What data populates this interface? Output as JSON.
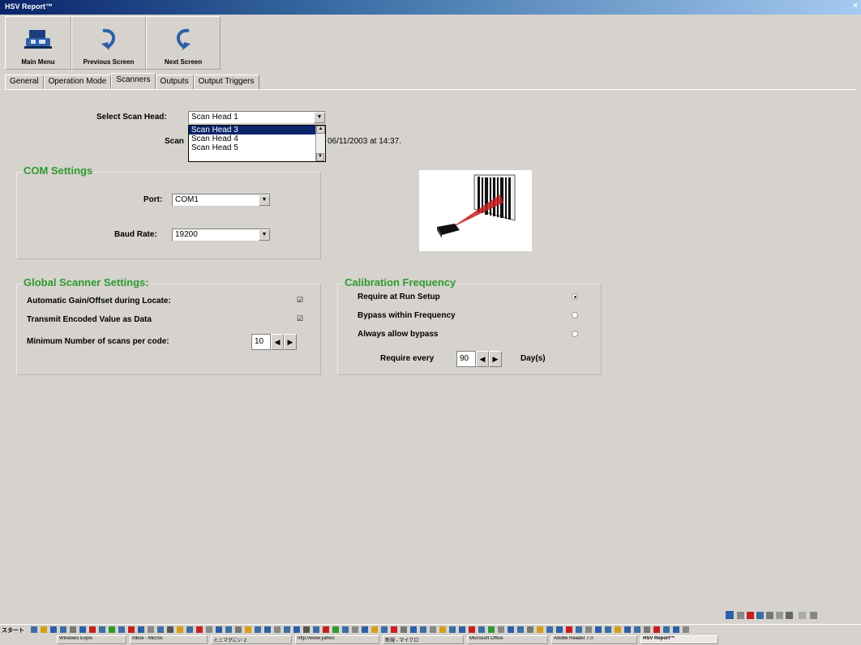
{
  "window": {
    "title": "HSV Report™",
    "close_glyph": "×"
  },
  "toolbar": {
    "main_menu": "Main Menu",
    "previous_screen": "Previous Screen",
    "next_screen": "Next Screen"
  },
  "tabs": [
    {
      "label": "General"
    },
    {
      "label": "Operation Mode"
    },
    {
      "label": "Scanners",
      "active": true
    },
    {
      "label": "Outputs"
    },
    {
      "label": "Output Triggers"
    }
  ],
  "scan_head": {
    "label": "Select Scan Head:",
    "value": "Scan Head 1",
    "options": [
      "Scan Head 3",
      "Scan Head 4",
      "Scan Head 5"
    ],
    "selected_option": "Scan Head 3",
    "status_prefix": "Scan",
    "status_suffix": "06/11/2003 at 14:37."
  },
  "com_settings": {
    "title": "COM Settings",
    "port_label": "Port:",
    "port_value": "COM1",
    "baud_label": "Baud Rate:",
    "baud_value": "19200"
  },
  "global": {
    "title": "Global Scanner Settings:",
    "auto_gain_label": "Automatic Gain/Offset during Locate:",
    "transmit_label": "Transmit Encoded Value as Data",
    "min_scans_label": "Minimum Number of scans per code:",
    "min_scans_value": "10",
    "check_glyph": "☑"
  },
  "calibration": {
    "title": "Calibration Frequency",
    "opt1": "Require at Run Setup",
    "opt2": "Bypass within Frequency",
    "opt3": "Always allow bypass",
    "require_every_label": "Require every",
    "require_every_value": "90",
    "days_label": "Day(s)"
  },
  "spin_glyphs": {
    "left": "◀",
    "right": "▶",
    "down": "▼",
    "up": "▲"
  },
  "taskbar": {
    "start_label": "スタート",
    "items": [
      "Windows Explo",
      "Inbox - Micros",
      "ミニマグにい 2",
      "http://www.yahoo",
      "新規 - マイクロ",
      "Microsoft Office",
      "Adobe Reader 7.0",
      "HSV Report™"
    ]
  },
  "colors": {
    "group_title": "#2f9a2f",
    "selection": "#0a246a",
    "window_bg": "#d6d3ce"
  }
}
